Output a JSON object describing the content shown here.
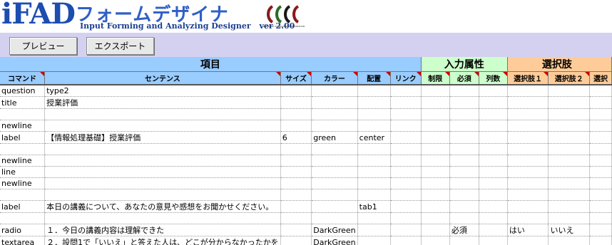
{
  "app": {
    "logo_main": "iFAD",
    "logo_japanese": "フォームデザイナ",
    "subtitle": "Input Forming and Analyzing Designer",
    "version": "ver 2.00",
    "mark_caption": "SOFTBANK CONSULTING CORPORATION"
  },
  "toolbar": {
    "preview_label": "プレビュー",
    "export_label": "エクスポート"
  },
  "sections": {
    "items": "項目",
    "input_attributes": "入力属性",
    "choices": "選択肢"
  },
  "columns": [
    "コマンド",
    "センテンス",
    "サイズ",
    "カラー",
    "配置",
    "リンク",
    "制限",
    "必須",
    "列数",
    "選択肢１",
    "選択肢２",
    "選択"
  ],
  "colors": {
    "blue": "#99ccff",
    "green": "#ccffcc",
    "orange": "#ffcc99",
    "toolbar": "#d4d1f0",
    "logo": "#2f5fc6"
  },
  "rows": [
    [
      "question",
      "type2",
      "",
      "",
      "",
      "",
      "",
      "",
      "",
      "",
      "",
      ""
    ],
    [
      "title",
      "授業評価",
      "",
      "",
      "",
      "",
      "",
      "",
      "",
      "",
      "",
      ""
    ],
    [
      "",
      "",
      "",
      "",
      "",
      "",
      "",
      "",
      "",
      "",
      "",
      ""
    ],
    [
      "newline",
      "",
      "",
      "",
      "",
      "",
      "",
      "",
      "",
      "",
      "",
      ""
    ],
    [
      "label",
      "【情報処理基礎】授業評価",
      "6",
      "green",
      "center",
      "",
      "",
      "",
      "",
      "",
      "",
      ""
    ],
    [
      "",
      "",
      "",
      "",
      "",
      "",
      "",
      "",
      "",
      "",
      "",
      ""
    ],
    [
      "newline",
      "",
      "",
      "",
      "",
      "",
      "",
      "",
      "",
      "",
      "",
      ""
    ],
    [
      "line",
      "",
      "",
      "",
      "",
      "",
      "",
      "",
      "",
      "",
      "",
      ""
    ],
    [
      "newline",
      "",
      "",
      "",
      "",
      "",
      "",
      "",
      "",
      "",
      "",
      ""
    ],
    [
      "",
      "",
      "",
      "",
      "",
      "",
      "",
      "",
      "",
      "",
      "",
      ""
    ],
    [
      "label",
      "本日の講義について、あなたの意見や感想をお聞かせください。",
      "",
      "",
      "tab1",
      "",
      "",
      "",
      "",
      "",
      "",
      ""
    ],
    [
      "",
      "",
      "",
      "",
      "",
      "",
      "",
      "",
      "",
      "",
      "",
      ""
    ],
    [
      "radio",
      "１．今日の講義内容は理解できた",
      "",
      "DarkGreen",
      "",
      "",
      "",
      "必須",
      "",
      "はい",
      "いいえ",
      ""
    ],
    [
      "textarea",
      "２．設問1で「いいえ」と答えた人は、どこが分からなかったかを",
      "",
      "DarkGreen",
      "",
      "",
      "",
      "",
      "",
      "",
      "",
      ""
    ]
  ]
}
